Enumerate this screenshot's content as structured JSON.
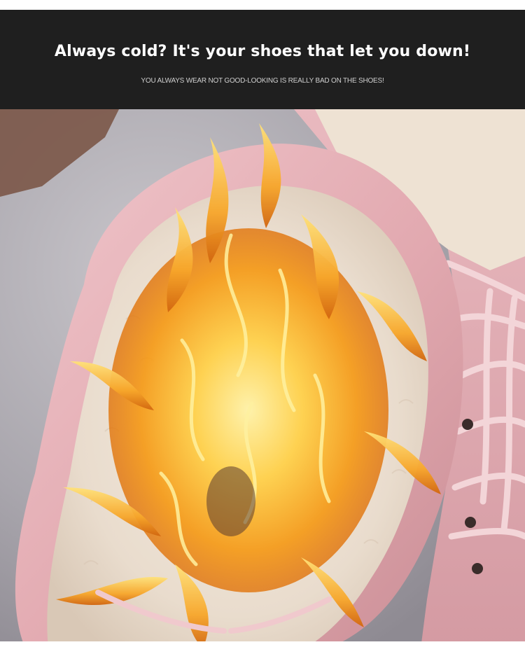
{
  "banner": {
    "headline": "Always cold? It's your shoes that let you down!",
    "subline": "YOU ALWAYS WEAR NOT GOOD-LOOKING IS REALLY BAD ON THE SHOES!",
    "background_color": "#1f1f1f",
    "text_color": "#ffffff"
  },
  "photo": {
    "subject": "pink-boot-fur-lining-with-flames",
    "boot_color": "#e8b7bd",
    "fur_color": "#efe3d6",
    "flame_color": "#f6a21a"
  }
}
